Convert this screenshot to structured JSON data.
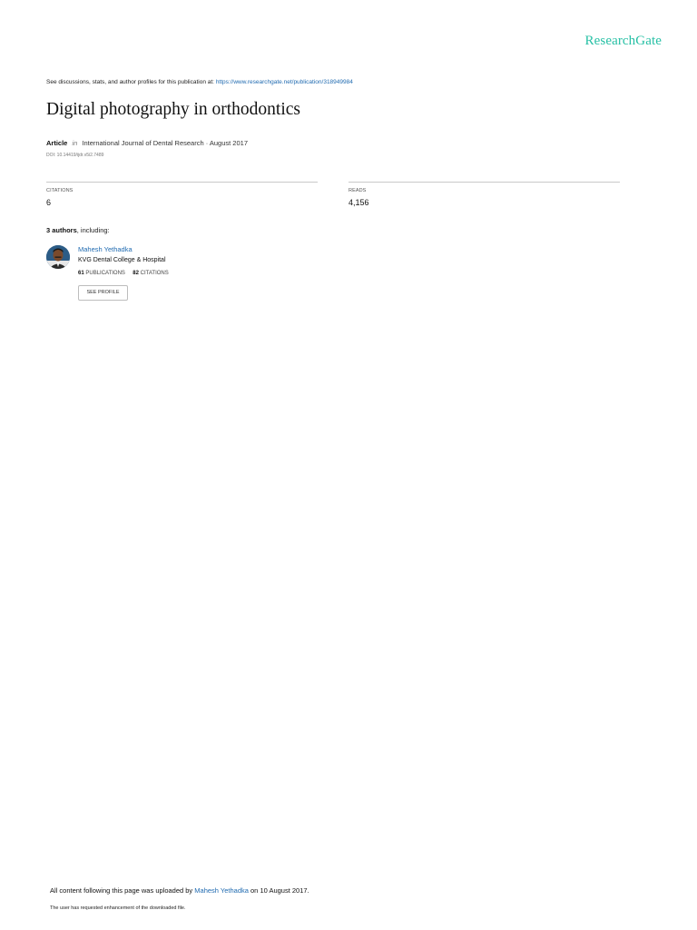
{
  "header": {
    "brand": "ResearchGate"
  },
  "discussion": {
    "prefix": "See discussions, stats, and author profiles for this publication at:",
    "url": "https://www.researchgate.net/publication/318949984"
  },
  "publication": {
    "title": "Digital photography in orthodontics",
    "kind": "Article",
    "in_word": "in",
    "venue": "International Journal of Dental Research · August 2017",
    "doi": "DOI: 10.14419/ijdr.v5i2.7489"
  },
  "stats": {
    "citations_label": "CITATIONS",
    "citations_value": "6",
    "reads_label": "READS",
    "reads_value": "4,156"
  },
  "authors": {
    "count_text": "3 authors",
    "suffix": ", including:",
    "items": [
      {
        "name": "Mahesh Yethadka",
        "affiliation": "KVG Dental College & Hospital",
        "publications": "61",
        "publications_label": "PUBLICATIONS",
        "citations": "82",
        "citations_label": "CITATIONS",
        "button_label": "SEE PROFILE"
      }
    ]
  },
  "footer": {
    "upload_prefix": "All content following this page was uploaded by",
    "uploader": "Mahesh Yethadka",
    "upload_suffix": "on 10 August 2017.",
    "enhancement": "The user has requested enhancement of the downloaded file."
  },
  "colors": {
    "brand": "#27c0a5",
    "link": "#1f6ab0"
  }
}
